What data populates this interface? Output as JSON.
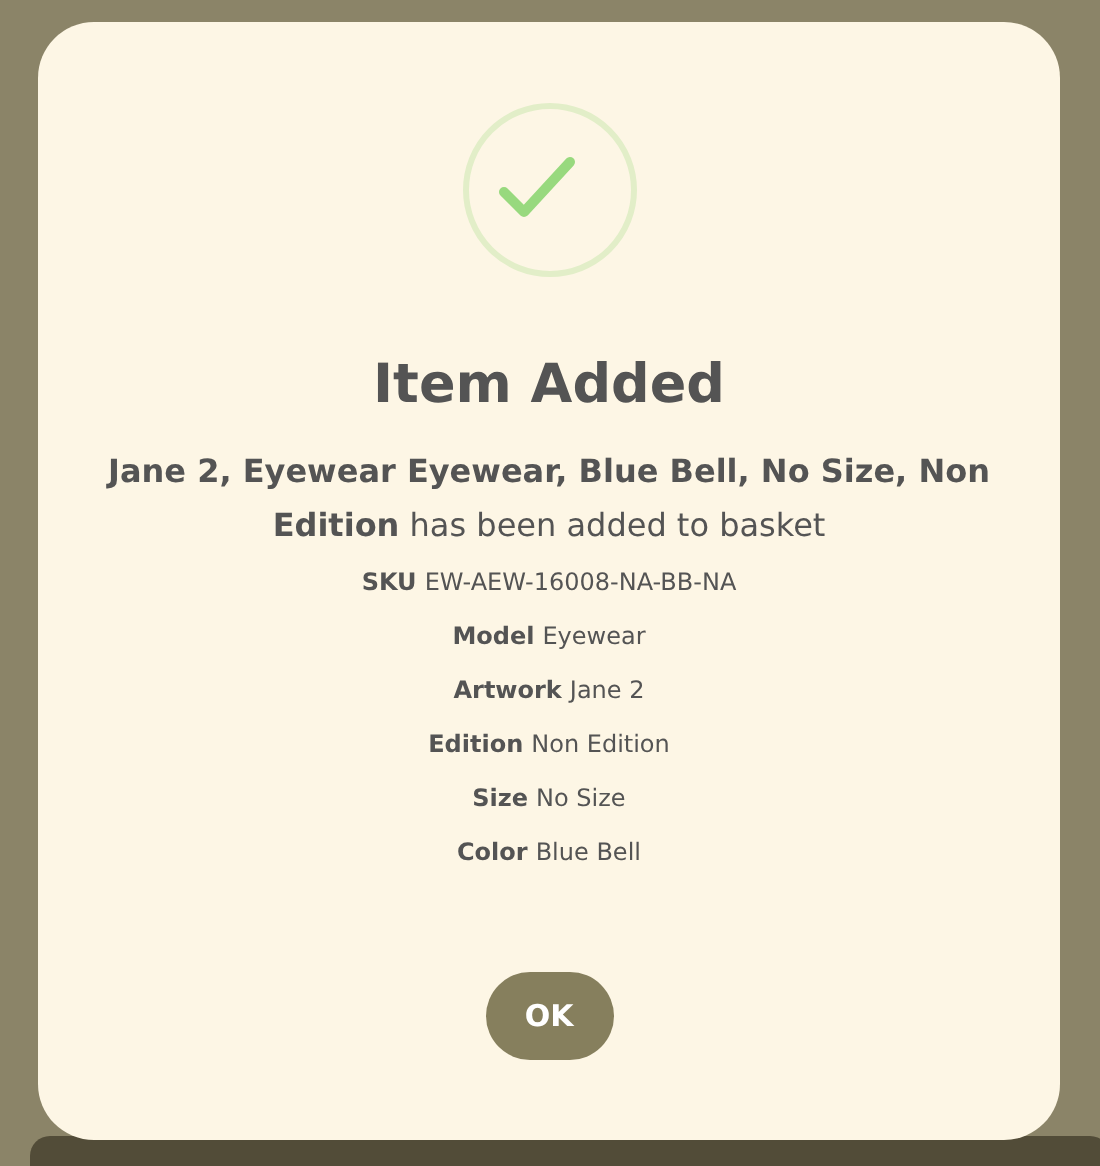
{
  "dialog": {
    "title": "Item Added",
    "message": "**Jane 2, Eyewear Eyewear, Blue Bell, No Size, Non Edition** has been added to basket",
    "details": [
      {
        "label": "SKU",
        "value": "EW-AEW-16008-NA-BB-NA"
      },
      {
        "label": "Model",
        "value": "Eyewear"
      },
      {
        "label": "Artwork",
        "value": "Jane 2"
      },
      {
        "label": "Edition",
        "value": "Non Edition"
      },
      {
        "label": "Size",
        "value": "No Size"
      },
      {
        "label": "Color",
        "value": "Blue Bell"
      }
    ],
    "button": "OK"
  }
}
